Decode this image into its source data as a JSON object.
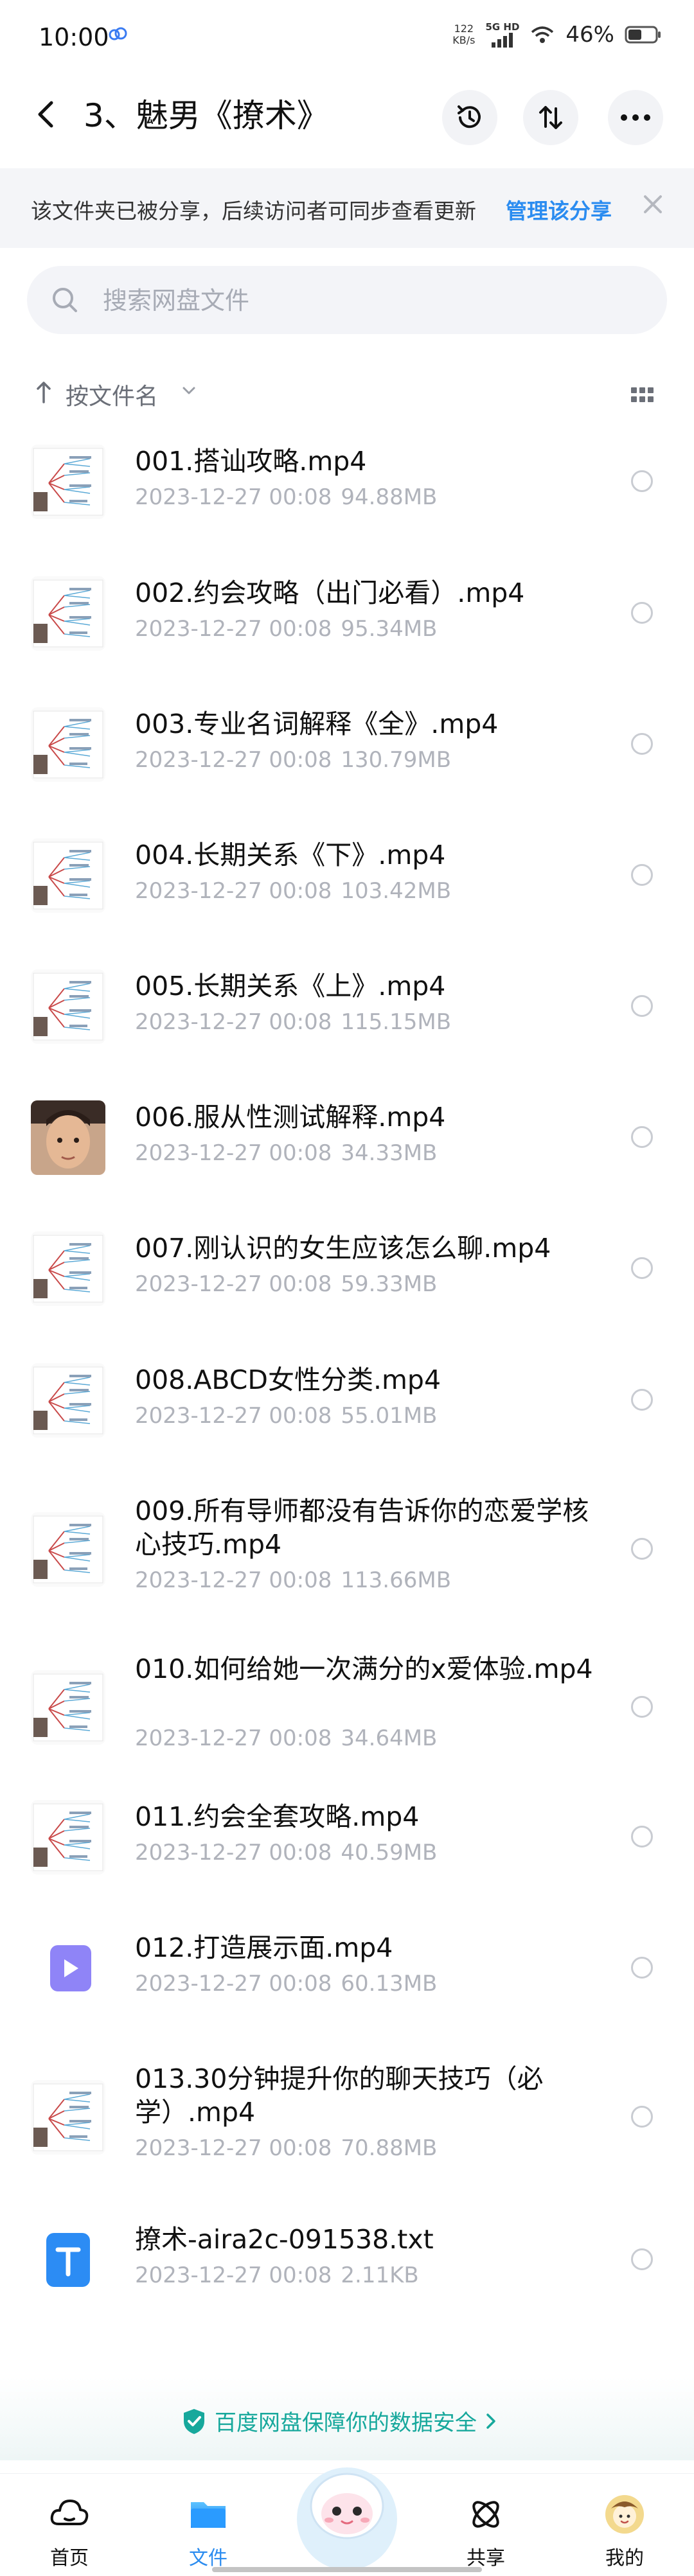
{
  "status_bar": {
    "time": "10:00",
    "net_speed_value": "122",
    "net_speed_unit": "KB/s",
    "signal_label": "5G HD",
    "battery": "46%"
  },
  "nav": {
    "title": "3、魅男《撩术》"
  },
  "share_banner": {
    "text": "该文件夹已被分享，后续访问者可同步查看更新",
    "link": "管理该分享"
  },
  "search": {
    "placeholder": "搜索网盘文件"
  },
  "sort": {
    "label": "按文件名"
  },
  "files": [
    {
      "name": "001.搭讪攻略.mp4",
      "date": "2023-12-27  00:08",
      "size": "94.88MB",
      "thumb": "mindmap"
    },
    {
      "name": "002.约会攻略（出门必看）.mp4",
      "date": "2023-12-27  00:08",
      "size": "95.34MB",
      "thumb": "mindmap"
    },
    {
      "name": "003.专业名词解释《全》.mp4",
      "date": "2023-12-27  00:08",
      "size": "130.79MB",
      "thumb": "mindmap"
    },
    {
      "name": "004.长期关系《下》.mp4",
      "date": "2023-12-27  00:08",
      "size": "103.42MB",
      "thumb": "mindmap"
    },
    {
      "name": "005.长期关系《上》.mp4",
      "date": "2023-12-27  00:08",
      "size": "115.15MB",
      "thumb": "mindmap"
    },
    {
      "name": "006.服从性测试解释.mp4",
      "date": "2023-12-27  00:08",
      "size": "34.33MB",
      "thumb": "face"
    },
    {
      "name": "007.刚认识的女生应该怎么聊.mp4",
      "date": "2023-12-27  00:08",
      "size": "59.33MB",
      "thumb": "mindmap"
    },
    {
      "name": "008.ABCD女性分类.mp4",
      "date": "2023-12-27  00:08",
      "size": "55.01MB",
      "thumb": "mindmap"
    },
    {
      "name": "009.所有导师都没有告诉你的恋爱学核心技巧.mp4",
      "date": "2023-12-27  00:08",
      "size": "113.66MB",
      "thumb": "mindmap"
    },
    {
      "name": "010.如何给她一次满分的x爱体验.mp4",
      "date": "2023-12-27  00:08",
      "size": "34.64MB",
      "thumb": "mindmap"
    },
    {
      "name": "011.约会全套攻略.mp4",
      "date": "2023-12-27  00:08",
      "size": "40.59MB",
      "thumb": "mindmap"
    },
    {
      "name": "012.打造展示面.mp4",
      "date": "2023-12-27  00:08",
      "size": "60.13MB",
      "thumb": "video-icon"
    },
    {
      "name": "013.30分钟提升你的聊天技巧（必学）.mp4",
      "date": "2023-12-27  00:08",
      "size": "70.88MB",
      "thumb": "mindmap"
    },
    {
      "name": "撩术-aira2c-091538.txt",
      "date": "2023-12-27  00:08",
      "size": "2.11KB",
      "thumb": "txt-icon"
    }
  ],
  "safety": {
    "text": "百度网盘保障你的数据安全"
  },
  "tabs": [
    {
      "label": "首页",
      "icon": "cloud-home-icon"
    },
    {
      "label": "文件",
      "icon": "folder-icon"
    },
    {
      "label": "",
      "icon": "mascot-icon"
    },
    {
      "label": "共享",
      "icon": "share-knot-icon"
    },
    {
      "label": "我的",
      "icon": "avatar-icon"
    }
  ],
  "colors": {
    "accent": "#2b8cf0",
    "safety": "#17a89c",
    "meta_text": "#b0b3bb"
  }
}
